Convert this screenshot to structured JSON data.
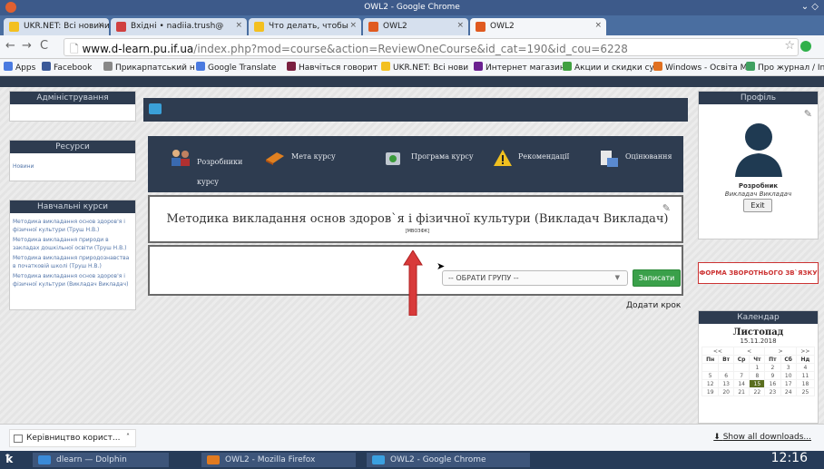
{
  "window": {
    "title": "OWL2 - Google Chrome"
  },
  "tabs": [
    {
      "label": "UKR.NET: Всі новини У",
      "color": "#f3c020"
    },
    {
      "label": "Вхідні • nadiia.trush@",
      "color": "#d04040"
    },
    {
      "label": "Что делать, чтобы",
      "color": "#f3c020"
    },
    {
      "label": "OWL2",
      "color": "#e05a20"
    },
    {
      "label": "OWL2",
      "color": "#e05a20"
    }
  ],
  "address": {
    "domain": "www.d-learn.pu.if.ua",
    "path": "/index.php?mod=course&action=ReviewOneCourse&id_cat=190&id_cou=6228"
  },
  "bookmarks": [
    {
      "label": "Apps",
      "color": "#4a7ae0"
    },
    {
      "label": "Facebook",
      "color": "#3b5998"
    },
    {
      "label": "Прикарпатський н",
      "color": "#888888"
    },
    {
      "label": "Google Translate",
      "color": "#4a7ae0"
    },
    {
      "label": "Навчіться говорит",
      "color": "#7a2040"
    },
    {
      "label": "UKR.NET: Всі нови",
      "color": "#f3c020"
    },
    {
      "label": "Интернет магазин",
      "color": "#6a2090"
    },
    {
      "label": "Акции и скидки су",
      "color": "#40a040"
    },
    {
      "label": "Windows - Освіта М",
      "color": "#e07020"
    },
    {
      "label": "Про журнал / Inter",
      "color": "#40a060"
    }
  ],
  "left": {
    "admin": "Адміністрування",
    "resources": "Ресурси",
    "resources_items": [
      "Новини"
    ],
    "courses_title": "Навчальні курси",
    "courses": [
      "Методика викладання основ здоров'я і фізичної культури (Труш Н.В.)",
      "Методика викладання природи в закладах дошкільної освіти (Труш Н.В.)",
      "Методика викладання природознавства в початковій школі (Труш Н.В.)",
      "Методика викладання основ здоров'я і фізичної культури (Викладач Викладач)"
    ]
  },
  "menu": [
    {
      "label": "Розробники курсу",
      "icon": "people-icon"
    },
    {
      "label": "Мета курсу",
      "icon": "book-icon"
    },
    {
      "label": "Програма курсу",
      "icon": "program-icon"
    },
    {
      "label": "Рекомендації",
      "icon": "warning-icon"
    },
    {
      "label": "Оцінювання",
      "icon": "evaluation-icon"
    }
  ],
  "course": {
    "title": "Методика викладання основ здоров`я і фізичної культури (Викладач Викладач)",
    "code": "[МВОЗФК]"
  },
  "group": {
    "select": "-- ОБРАТИ ГРУПУ --",
    "enroll": "Записати"
  },
  "add_step": "Додати крок",
  "right": {
    "profile": "Профіль",
    "role": "Розробник",
    "name": "Викладач Викладач",
    "exit": "Exit",
    "feedback": "ФОРМА ЗВОРОТНЬОГО ЗВ`ЯЗКУ",
    "calendar_title": "Календар",
    "month": "Листопад",
    "date": "15.11.2018",
    "nav": [
      "<<",
      "<",
      ">",
      ">>"
    ],
    "days": [
      "Пн",
      "Вт",
      "Ср",
      "Чт",
      "Пт",
      "Сб",
      "Нд"
    ],
    "weeks": [
      [
        "",
        "",
        "",
        "1",
        "2",
        "3",
        "4"
      ],
      [
        "5",
        "6",
        "7",
        "8",
        "9",
        "10",
        "11"
      ],
      [
        "12",
        "13",
        "14",
        "15",
        "16",
        "17",
        "18"
      ],
      [
        "19",
        "20",
        "21",
        "22",
        "23",
        "24",
        "25"
      ]
    ],
    "today": "15"
  },
  "downloads": {
    "item": "Керівництво корист...",
    "show_all": "Show all downloads..."
  },
  "taskbar": {
    "items": [
      {
        "label": "dlearn — Dolphin",
        "color": "#3a8ad8"
      },
      {
        "label": "OWL2 - Mozilla Firefox",
        "color": "#e07a20"
      },
      {
        "label": "OWL2 - Google Chrome",
        "color": "#3aa0e0"
      }
    ],
    "clock": "12:16"
  }
}
